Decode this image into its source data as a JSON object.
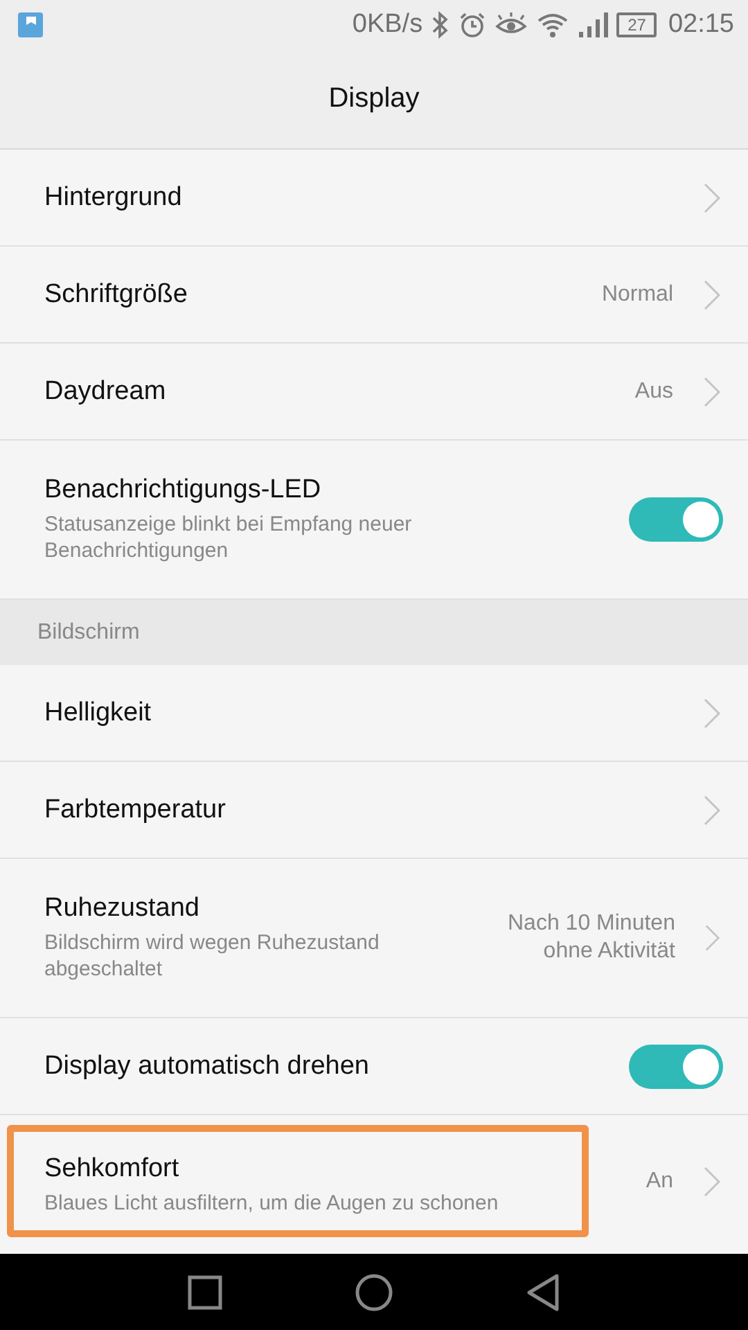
{
  "status_bar": {
    "speed": "0KB/s",
    "battery": "27",
    "time": "02:15"
  },
  "title": "Display",
  "items": [
    {
      "kind": "link",
      "label": "Hintergrund"
    },
    {
      "kind": "link",
      "label": "Schriftgröße",
      "value": "Normal"
    },
    {
      "kind": "link",
      "label": "Daydream",
      "value": "Aus"
    },
    {
      "kind": "toggle",
      "label": "Benachrichtigungs-LED",
      "subtitle": "Statusanzeige blinkt bei Empfang neuer Benachrichtigungen",
      "on": true
    },
    {
      "kind": "header",
      "label": "Bildschirm"
    },
    {
      "kind": "link",
      "label": "Helligkeit"
    },
    {
      "kind": "link",
      "label": "Farbtemperatur"
    },
    {
      "kind": "link",
      "label": "Ruhezustand",
      "subtitle": "Bildschirm wird wegen Ruhezustand abgeschaltet",
      "value": "Nach 10 Minuten ohne Aktivität"
    },
    {
      "kind": "toggle",
      "label": "Display automatisch drehen",
      "on": true
    },
    {
      "kind": "link",
      "label": "Sehkomfort",
      "subtitle": "Blaues Licht ausfiltern, um die Augen zu schonen",
      "value": "An",
      "highlighted": true
    }
  ]
}
